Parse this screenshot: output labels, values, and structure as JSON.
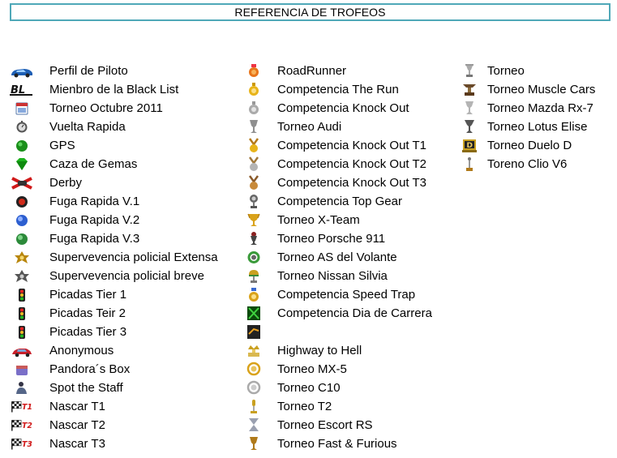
{
  "header": {
    "title": "REFERENCIA DE TROFEOS"
  },
  "colors": {
    "header_border": "#4fa8b8"
  },
  "columns": [
    {
      "items": [
        {
          "label": "Perfil de Piloto",
          "icon": "car-icon"
        },
        {
          "label": "Mienbro de la Black List",
          "icon": "bl-logo-icon"
        },
        {
          "label": "Torneo Octubre 2011",
          "icon": "calendar-icon"
        },
        {
          "label": "Vuelta Rapida",
          "icon": "stopwatch-icon"
        },
        {
          "label": "GPS",
          "icon": "green-dot-icon"
        },
        {
          "label": "Caza de Gemas",
          "icon": "gem-icon"
        },
        {
          "label": "Derby",
          "icon": "derby-x-icon"
        },
        {
          "label": "Fuga Rapida V.1",
          "icon": "red-orb-icon"
        },
        {
          "label": "Fuga Rapida V.2",
          "icon": "blue-orb-icon"
        },
        {
          "label": "Fuga Rapida V.3",
          "icon": "green-orb-icon"
        },
        {
          "label": "Supervevencia policial Extensa",
          "icon": "gold-badge-icon"
        },
        {
          "label": "Supervevencia policial breve",
          "icon": "silver-badge-icon"
        },
        {
          "label": "Picadas Tier 1",
          "icon": "traffic-light-icon"
        },
        {
          "label": "Picadas Teir 2",
          "icon": "traffic-light-icon"
        },
        {
          "label": "Picadas Tier 3",
          "icon": "traffic-light-icon"
        },
        {
          "label": "Anonymous",
          "icon": "red-car-icon"
        },
        {
          "label": "Pandora´s Box",
          "icon": "box-icon"
        },
        {
          "label": "Spot the Staff",
          "icon": "person-icon"
        },
        {
          "label": "Nascar T1",
          "icon": "checkered-flag-t1-icon",
          "tag": "T1"
        },
        {
          "label": "Nascar T2",
          "icon": "checkered-flag-t2-icon",
          "tag": "T2"
        },
        {
          "label": "Nascar T3",
          "icon": "checkered-flag-t3-icon",
          "tag": "T3"
        }
      ]
    },
    {
      "items": [
        {
          "label": "RoadRunner",
          "icon": "orange-medal-icon"
        },
        {
          "label": "Competencia The Run",
          "icon": "gold-medal-icon"
        },
        {
          "label": "Competencia  Knock Out",
          "icon": "silver-medal-icon"
        },
        {
          "label": "Torneo Audi",
          "icon": "silver-trophy-icon"
        },
        {
          "label": "Competencia  Knock Out T1",
          "icon": "gold-ribbon-medal-icon"
        },
        {
          "label": "Competencia  Knock Out T2",
          "icon": "silver-ribbon-medal-icon"
        },
        {
          "label": "Competencia  Knock Out T3",
          "icon": "bronze-ribbon-medal-icon"
        },
        {
          "label": "Competencia Top Gear",
          "icon": "top-gear-trophy-icon"
        },
        {
          "label": "Torneo X-Team",
          "icon": "gold-cup-icon"
        },
        {
          "label": "Torneo Porsche 911",
          "icon": "dark-trophy-icon"
        },
        {
          "label": "Torneo AS del Volante",
          "icon": "wheel-wreath-icon"
        },
        {
          "label": "Torneo Nissan Silvia",
          "icon": "helmet-trophy-icon"
        },
        {
          "label": "Competencia Speed Trap",
          "icon": "speed-medal-icon"
        },
        {
          "label": "Competencia Dia de Carrera",
          "icon": "green-square-icon"
        },
        {
          "label": "",
          "icon": "dark-square-icon"
        },
        {
          "label": "Highway to Hell",
          "icon": "crown-trophy-icon"
        },
        {
          "label": "Torneo MX-5",
          "icon": "gold-wreath-icon"
        },
        {
          "label": "Torneo C10",
          "icon": "silver-wreath-icon"
        },
        {
          "label": "Torneo T2",
          "icon": "slim-trophy-icon"
        },
        {
          "label": "Torneo Escort RS",
          "icon": "hourglass-trophy-icon"
        },
        {
          "label": "Torneo Fast & Furious",
          "icon": "bronze-trophy-icon"
        }
      ]
    },
    {
      "items": [
        {
          "label": "Torneo",
          "icon": "small-trophy-icon"
        },
        {
          "label": "Torneo Muscle Cars",
          "icon": "anvil-trophy-icon"
        },
        {
          "label": "Torneo Mazda Rx-7",
          "icon": "silver-goblet-icon"
        },
        {
          "label": "Torneo Lotus Elise",
          "icon": "dark-goblet-icon"
        },
        {
          "label": "Torneo Duelo D",
          "icon": "d-plaque-icon"
        },
        {
          "label": "Toreno Clio V6",
          "icon": "tall-trophy-icon"
        }
      ]
    }
  ]
}
